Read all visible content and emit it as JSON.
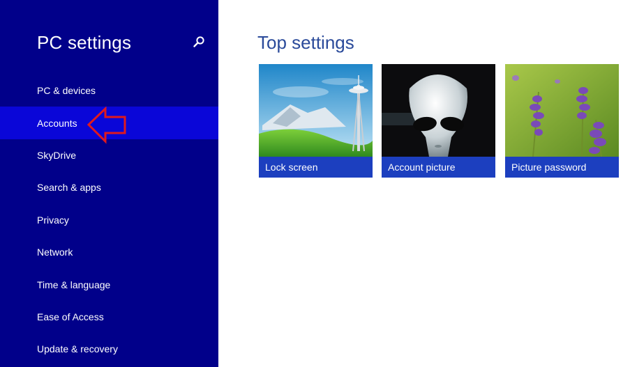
{
  "sidebar": {
    "title": "PC settings",
    "search_icon": "search-icon",
    "background": "#01008a",
    "selected_background": "#0a06d8",
    "items": [
      {
        "label": "PC & devices",
        "selected": false
      },
      {
        "label": "Accounts",
        "selected": true
      },
      {
        "label": "SkyDrive",
        "selected": false
      },
      {
        "label": "Search & apps",
        "selected": false
      },
      {
        "label": "Privacy",
        "selected": false
      },
      {
        "label": "Network",
        "selected": false
      },
      {
        "label": "Time & language",
        "selected": false
      },
      {
        "label": "Ease of Access",
        "selected": false
      },
      {
        "label": "Update & recovery",
        "selected": false
      }
    ]
  },
  "annotation": {
    "icon": "red-arrow-icon",
    "color": "#e0191e"
  },
  "main": {
    "title": "Top settings",
    "title_color": "#2a4a9a",
    "tiles": [
      {
        "label": "Lock screen",
        "icon": "lock-screen-image"
      },
      {
        "label": "Account picture",
        "icon": "account-picture-image"
      },
      {
        "label": "Picture password",
        "icon": "picture-password-image"
      }
    ],
    "tile_label_color": "#1c3fbf"
  }
}
